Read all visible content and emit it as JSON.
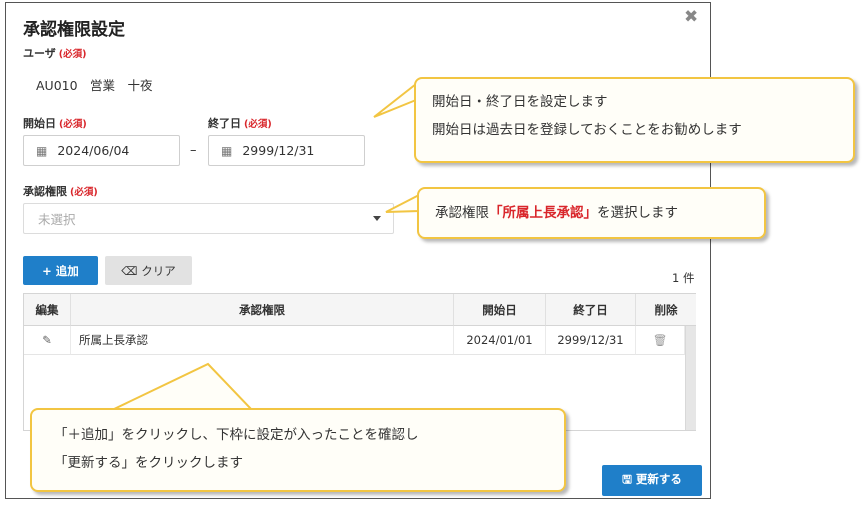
{
  "dialog": {
    "title": "承認権限設定",
    "close_symbol": "✖"
  },
  "form": {
    "user_label": "ユーザ",
    "required_label": "(必須)",
    "user_value": "AU010　営業　十夜",
    "start_label": "開始日",
    "start_value": "2024/06/04",
    "range_separator": "–",
    "end_label": "終了日",
    "end_value": "2999/12/31",
    "authority_label": "承認権限",
    "authority_placeholder": "未選択",
    "calendar_symbol": "▦"
  },
  "actions": {
    "add_label": "+ 追加",
    "clear_label": "⌫ クリア",
    "count_text": "1 件",
    "update_label": "🖫 更新する"
  },
  "table": {
    "columns": [
      "編集",
      "承認権限",
      "開始日",
      "終了日",
      "削除"
    ],
    "rows": [
      {
        "edit_icon": "✎",
        "authority": "所属上長承認",
        "start": "2024/01/01",
        "end": "2999/12/31",
        "delete_icon": "🗑"
      }
    ]
  },
  "callouts": {
    "dates_line1": "開始日・終了日を設定します",
    "dates_line2": "開始日は過去日を登録しておくことをお勧めします",
    "authority_prefix": "承認権限",
    "authority_highlight": "「所属上長承認」",
    "authority_suffix": "を選択します",
    "add_line1": "「＋追加」をクリックし、下枠に設定が入ったことを確認し",
    "add_line2": "「更新する」をクリックします"
  },
  "colors": {
    "primary_blue": "#1f7fc9",
    "required_red": "#d9262b",
    "callout_border": "#f2c542",
    "callout_fill": "#fffef8"
  }
}
